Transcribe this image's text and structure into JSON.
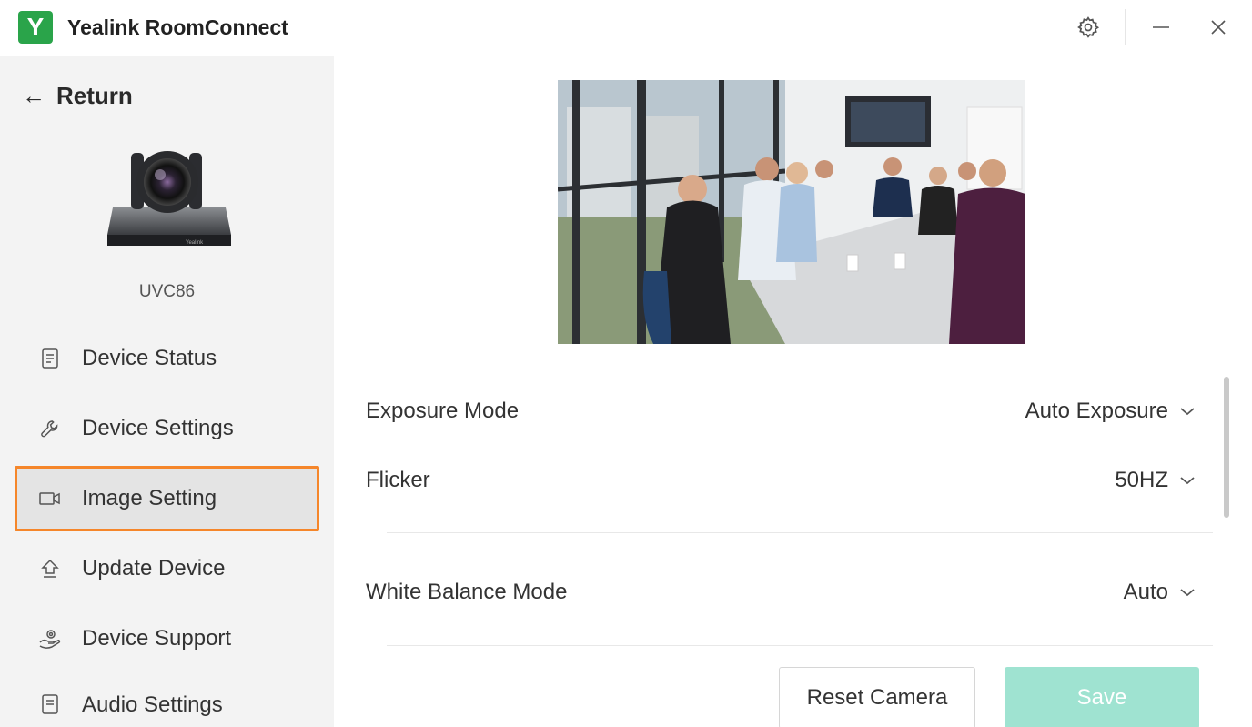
{
  "app": {
    "logo_letter": "Y",
    "title": "Yealink RoomConnect",
    "accent_color": "#2aa44a",
    "window_controls": [
      "gear-icon",
      "minimize-icon",
      "close-icon"
    ]
  },
  "sidebar": {
    "return_label": "Return",
    "device_model": "UVC86",
    "items": [
      {
        "label": "Device Status",
        "icon": "document-icon"
      },
      {
        "label": "Device Settings",
        "icon": "wrench-icon"
      },
      {
        "label": "Image Setting",
        "icon": "video-camera-icon",
        "active": true
      },
      {
        "label": "Update Device",
        "icon": "upload-icon"
      },
      {
        "label": "Device Support",
        "icon": "support-hand-icon"
      },
      {
        "label": "Audio Settings",
        "icon": "document-icon"
      }
    ],
    "active_border_color": "#f5862a"
  },
  "settings": {
    "exposure_mode": {
      "label": "Exposure Mode",
      "value": "Auto Exposure"
    },
    "flicker": {
      "label": "Flicker",
      "value": "50HZ"
    },
    "white_balance_mode": {
      "label": "White Balance Mode",
      "value": "Auto"
    }
  },
  "actions": {
    "reset_label": "Reset Camera",
    "save_label": "Save",
    "save_color": "#9fe3d1"
  }
}
